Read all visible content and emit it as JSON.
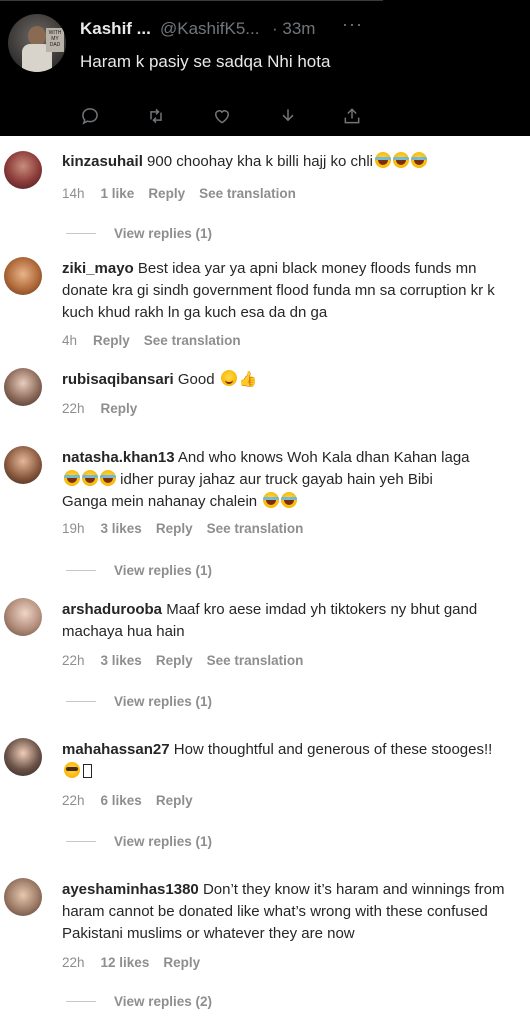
{
  "tweet": {
    "name": "Kashif ...",
    "handle": "@KashifK5...",
    "time": "· 33m",
    "more": "···",
    "text": "Haram k pasiy se sadqa Nhi hota",
    "avatar_caption": "WITH MY DAD"
  },
  "comments": [
    {
      "username": "kinzasuhail",
      "text": "900 choohay kha k billi hajj ko chli",
      "emojis": [
        "laugh",
        "laugh",
        "laugh"
      ],
      "age": "14h",
      "likes": "1 like",
      "reply": "Reply",
      "translation": "See translation",
      "view_replies": "View replies (1)"
    },
    {
      "username": "ziki_mayo",
      "text": "Best idea yar ya apni black money floods funds mn donate kra gi sindh government flood funda mn sa corruption kr k kuch khud rakh ln ga kuch esa da dn ga",
      "age": "4h",
      "reply": "Reply",
      "translation": "See translation"
    },
    {
      "username": "rubisaqibansari",
      "text": "Good",
      "emojis": [
        "smile",
        "thumbs-up"
      ],
      "age": "22h",
      "reply": "Reply"
    },
    {
      "username": "natasha.khan13",
      "text_line1": "And who knows Woh Kala dhan Kahan laga",
      "text_line2": "idher puray jahaz aur truck gayab hain yeh Bibi",
      "text_line3": "Ganga mein nahanay chalein",
      "age": "19h",
      "likes": "3 likes",
      "reply": "Reply",
      "translation": "See translation",
      "view_replies": "View replies (1)"
    },
    {
      "username": "arshadurooba",
      "text": "Maaf kro aese imdad yh tiktokers ny bhut gand machaya hua hain",
      "age": "22h",
      "likes": "3 likes",
      "reply": "Reply",
      "translation": "See translation",
      "view_replies": "View replies (1)"
    },
    {
      "username": "mahahassan27",
      "text": "How thoughtful and generous of these stooges!!",
      "age": "22h",
      "likes": "6 likes",
      "reply": "Reply",
      "view_replies": "View replies (1)"
    },
    {
      "username": "ayeshaminhas1380",
      "text": "Don’t they know it’s haram and winnings from haram cannot be donated like what’s wrong with these confused Pakistani muslims or whatever they are now",
      "age": "22h",
      "likes": "12 likes",
      "reply": "Reply",
      "view_replies": "View replies (2)"
    }
  ],
  "icons": [
    "reply-icon",
    "retweet-icon",
    "like-icon",
    "download-icon",
    "share-icon"
  ]
}
